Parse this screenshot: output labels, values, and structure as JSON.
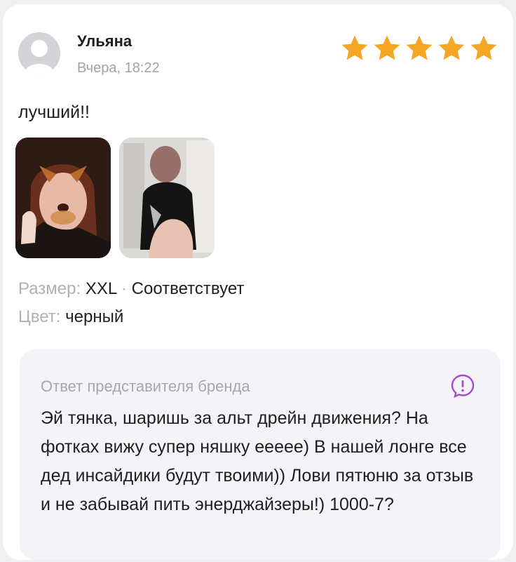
{
  "review": {
    "author": "Ульяна",
    "date": "Вчера, 18:22",
    "rating": 5,
    "rating_max": 5,
    "star_color": "#f5a623",
    "text": "лучший!!",
    "photos": [
      "photo-selfie-icon",
      "photo-mirror-icon"
    ],
    "size_label": "Размер:",
    "size_value": "XXL",
    "separator": "·",
    "fit_value": "Соответствует",
    "color_label": "Цвет:",
    "color_value": "черный"
  },
  "reply": {
    "title": "Ответ представителя бренда",
    "icon": "brand-chat-icon",
    "accent": "#a64ac9",
    "text": "Эй тянка, шаришь за альт дрейн движения? На фотках вижу супер няшку еееее) В нашей лонге все дед инсайдики будут твоими)) Лови пятюню за отзыв и не забывай пить энерджайзеры!) 1000-7?"
  }
}
